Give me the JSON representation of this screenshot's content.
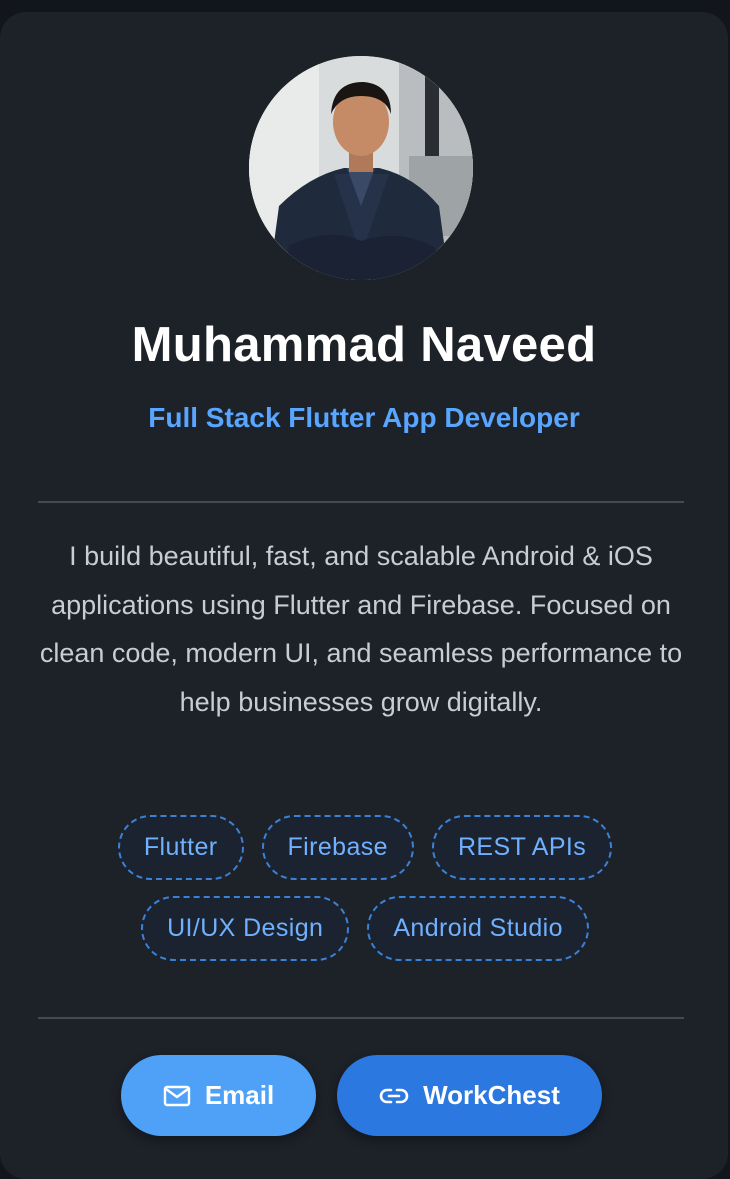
{
  "profile": {
    "name": "Muhammad Naveed",
    "role": "Full Stack Flutter App Developer",
    "bio": "I build beautiful, fast, and scalable Android & iOS applications using Flutter and Firebase. Focused on clean code, modern UI, and seamless performance to help businesses grow digitally."
  },
  "skills": [
    "Flutter",
    "Firebase",
    "REST APIs",
    "UI/UX Design",
    "Android Studio"
  ],
  "actions": {
    "email_label": "Email",
    "email_icon": "mail-icon",
    "workchest_label": "WorkChest",
    "workchest_icon": "link-icon"
  },
  "colors": {
    "accent": "#58a6ff",
    "card_bg": "#1d2128",
    "email_button": "#4ea1f6",
    "workchest_button": "#2b78e0"
  }
}
